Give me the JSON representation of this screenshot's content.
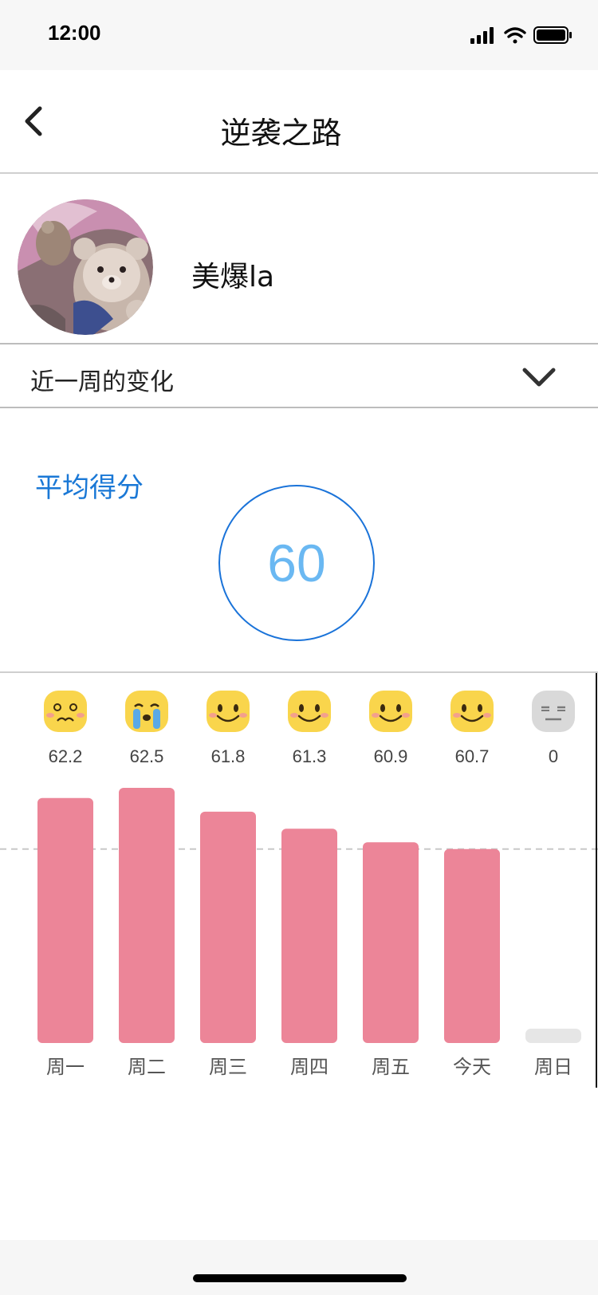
{
  "status_bar": {
    "time": "12:00"
  },
  "nav": {
    "title": "逆袭之路",
    "back_icon": "chevron-left-icon"
  },
  "profile": {
    "username": "美爆la",
    "avatar_icon": "plush-bear-avatar"
  },
  "period": {
    "label": "近一周的变化",
    "toggle_icon": "chevron-down-icon"
  },
  "score": {
    "label": "平均得分",
    "value": "60"
  },
  "colors": {
    "accent": "#1a78d6",
    "score_text": "#6ab8f2",
    "bar": "#ec8598",
    "bar_empty": "#e6e6e6",
    "emoji_face": "#f9d54c",
    "emoji_face_neutral": "#d9d9d9"
  },
  "chart_data": {
    "type": "bar",
    "categories": [
      "周一",
      "周二",
      "周三",
      "周四",
      "周五",
      "今天",
      "周日"
    ],
    "values": [
      62.2,
      62.5,
      61.8,
      61.3,
      60.9,
      60.7,
      0
    ],
    "value_labels": [
      "62.2",
      "62.5",
      "61.8",
      "61.3",
      "60.9",
      "60.7",
      "0"
    ],
    "moods": [
      "worried",
      "crying",
      "smile",
      "smile",
      "smile",
      "smile",
      "neutral"
    ],
    "reference_line": 60.7,
    "grid": false,
    "legend": "none"
  }
}
